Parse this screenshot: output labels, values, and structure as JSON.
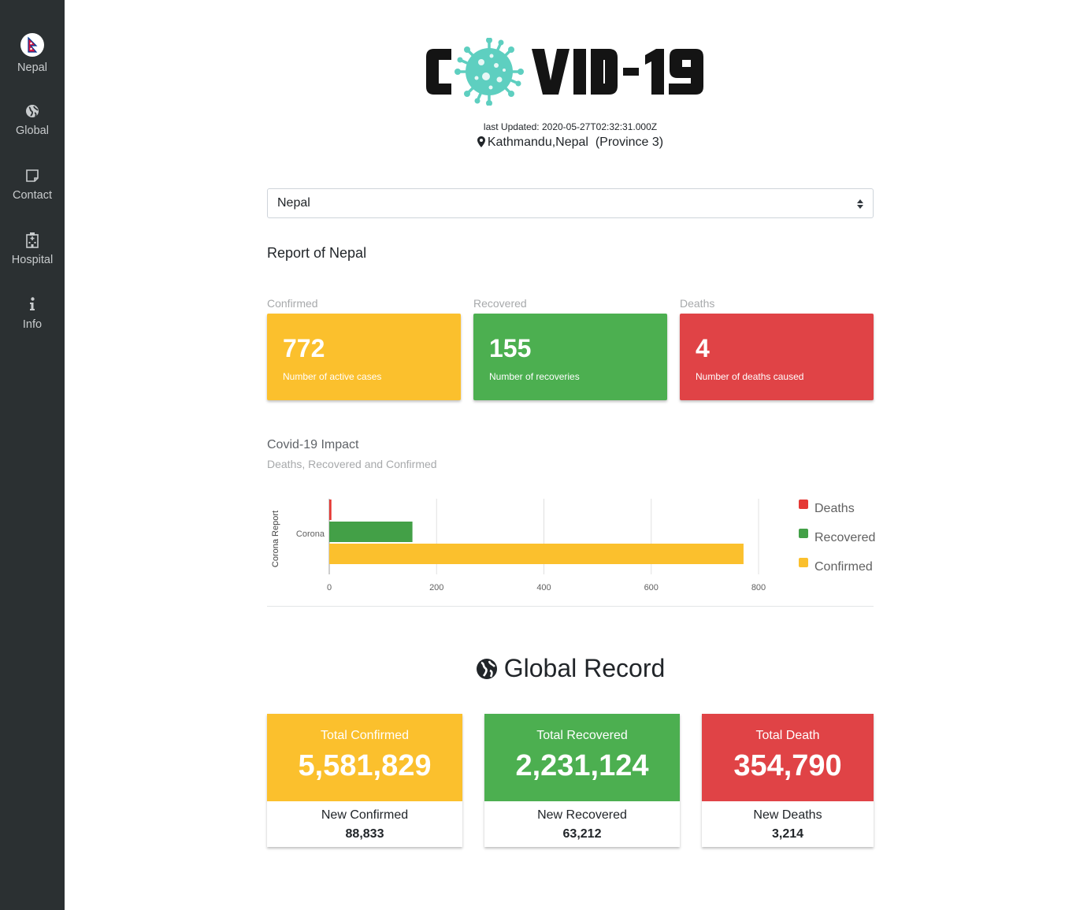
{
  "sidebar": {
    "items": [
      {
        "label": "Nepal",
        "icon": "nepal-flag-icon"
      },
      {
        "label": "Global",
        "icon": "globe-icon"
      },
      {
        "label": "Contact",
        "icon": "note-icon"
      },
      {
        "label": "Hospital",
        "icon": "hospital-icon"
      },
      {
        "label": "Info",
        "icon": "info-icon"
      }
    ]
  },
  "header": {
    "logo_text": "COVID-19",
    "last_updated": "last Updated: 2020-05-27T02:32:31.000Z",
    "location": "Kathmandu,Nepal  (Province 3)"
  },
  "country_select": {
    "value": "Nepal"
  },
  "report": {
    "title": "Report of Nepal",
    "confirmed": {
      "label": "Confirmed",
      "value": "772",
      "desc": "Number of active cases"
    },
    "recovered": {
      "label": "Recovered",
      "value": "155",
      "desc": "Number of recoveries"
    },
    "deaths": {
      "label": "Deaths",
      "value": "4",
      "desc": "Number of deaths caused"
    }
  },
  "impact": {
    "title": "Covid-19 Impact",
    "subtitle": "Deaths, Recovered and Confirmed"
  },
  "chart_data": {
    "type": "bar",
    "orientation": "horizontal",
    "categories": [
      "Corona"
    ],
    "ylabel": "Corona Report",
    "xlabel": "",
    "xlim": [
      0,
      800
    ],
    "xticks": [
      0,
      200,
      400,
      600,
      800
    ],
    "grid": true,
    "legend": "right",
    "series": [
      {
        "name": "Deaths",
        "values": [
          4
        ],
        "color": "#e53935"
      },
      {
        "name": "Recovered",
        "values": [
          155
        ],
        "color": "#43a047"
      },
      {
        "name": "Confirmed",
        "values": [
          772
        ],
        "color": "#fbc02d"
      }
    ]
  },
  "global": {
    "title": "Global Record",
    "cards": [
      {
        "label": "Total Confirmed",
        "value": "5,581,829",
        "new_label": "New Confirmed",
        "new_value": "88,833",
        "color": "#fbc02d"
      },
      {
        "label": "Total Recovered",
        "value": "2,231,124",
        "new_label": "New Recovered",
        "new_value": "63,212",
        "color": "#4caf50"
      },
      {
        "label": "Total Death",
        "value": "354,790",
        "new_label": "New Deaths",
        "new_value": "3,214",
        "color": "#e04346"
      }
    ]
  },
  "colors": {
    "sidebar_bg": "#2b3032",
    "confirmed": "#fbc02d",
    "recovered": "#4caf50",
    "deaths": "#e04346",
    "logo_virus": "#5ecfc0"
  }
}
